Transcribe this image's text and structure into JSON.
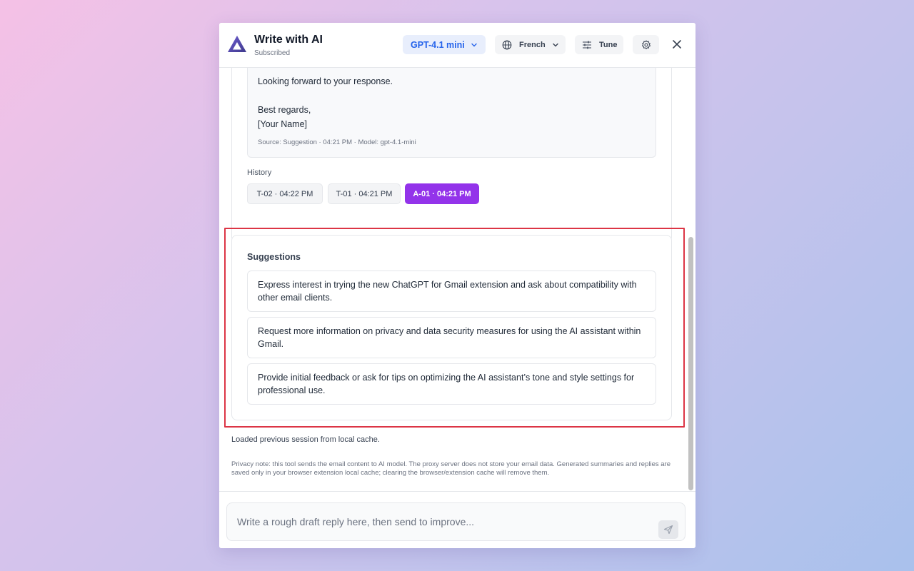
{
  "header": {
    "title": "Write with AI",
    "subtitle": "Subscribed",
    "model_label": "GPT-4.1 mini",
    "language_label": "French",
    "tune_label": "Tune"
  },
  "message": {
    "lines": [
      "Looking forward to your response.",
      "Best regards,",
      "[Your Name]"
    ],
    "meta": "Source: Suggestion · 04:21 PM · Model: gpt-4.1-mini"
  },
  "history": {
    "label": "History",
    "items": [
      {
        "label": "T-02 · 04:22 PM",
        "active": false
      },
      {
        "label": "T-01 · 04:21 PM",
        "active": false
      },
      {
        "label": "A-01 · 04:21 PM",
        "active": true
      }
    ]
  },
  "suggestions": {
    "title": "Suggestions",
    "items": [
      "Express interest in trying the new ChatGPT for Gmail extension and ask about compatibility with other email clients.",
      "Request more information on privacy and data security measures for using the AI assistant within Gmail.",
      "Provide initial feedback or ask for tips on optimizing the AI assistant’s tone and style settings for professional use."
    ]
  },
  "status_text": "Loaded previous session from local cache.",
  "privacy_note": "Privacy note: this tool sends the email content to AI model. The proxy server does not store your email data. Generated summaries and replies are saved only in your browser extension local cache; clearing the browser/extension cache will remove them.",
  "composer": {
    "placeholder": "Write a rough draft reply here, then send to improve..."
  },
  "colors": {
    "accent": "#9333ea",
    "model_accent": "#2563eb",
    "highlight": "#dc3545"
  }
}
